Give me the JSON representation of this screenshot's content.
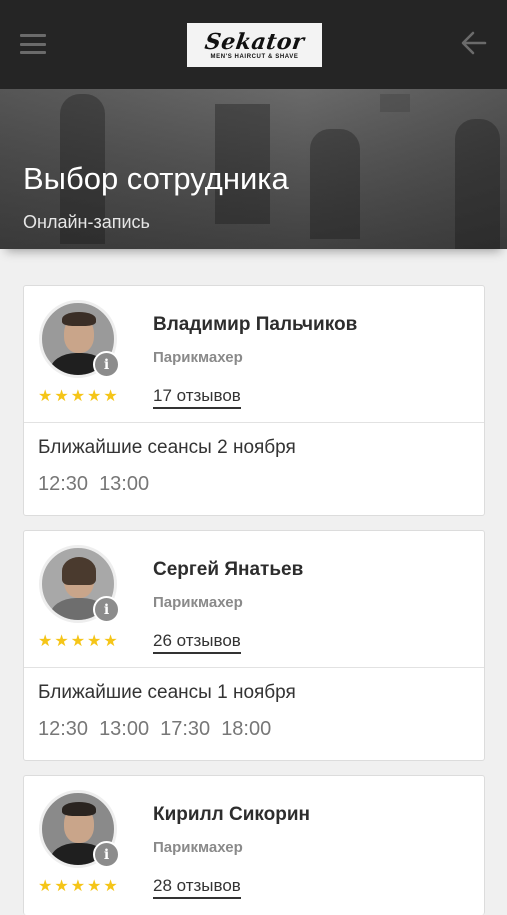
{
  "header": {
    "logo_script": "Sekator",
    "logo_sub": "MEN'S HAIRCUT & SHAVE",
    "menu_icon": "hamburger-menu-icon",
    "back_icon": "arrow-left-icon"
  },
  "hero": {
    "title": "Выбор сотрудника",
    "subtitle": "Онлайн-запись"
  },
  "colors": {
    "topbar": "#252525",
    "star": "#f5c518",
    "time_text": "#777777"
  },
  "employees": [
    {
      "name": "Владимир Пальчиков",
      "role": "Парикмахер",
      "reviews": "17 отзывов",
      "rating_stars": 5,
      "sessions_title": "Ближайшие сеансы 2 ноября",
      "times": [
        "12:30",
        "13:00"
      ]
    },
    {
      "name": "Сергей Янатьев",
      "role": "Парикмахер",
      "reviews": "26 отзывов",
      "rating_stars": 5,
      "sessions_title": "Ближайшие сеансы 1 ноября",
      "times": [
        "12:30",
        "13:00",
        "17:30",
        "18:00"
      ]
    },
    {
      "name": "Кирилл Сикорин",
      "role": "Парикмахер",
      "reviews": "28 отзывов",
      "rating_stars": 5,
      "sessions_title": "",
      "times": []
    }
  ]
}
